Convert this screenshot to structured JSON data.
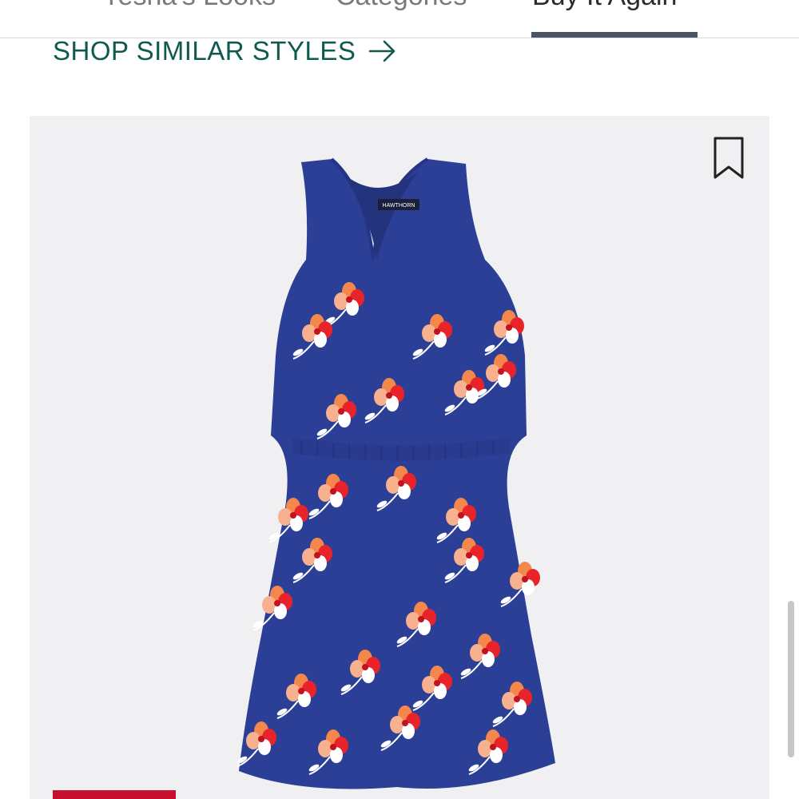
{
  "tabs": [
    {
      "label": "Yesha's Looks"
    },
    {
      "label": "Categories"
    },
    {
      "label": "Buy It Again",
      "active": true
    }
  ],
  "shop_similar": {
    "label": "SHOP SIMILAR STYLES",
    "icon": "arrow-right-icon"
  },
  "product": {
    "image": "blue-floral-sleeveless-dress",
    "brand_tag": "HAWTHORN",
    "bookmark_icon": "bookmark-icon"
  },
  "colors": {
    "link": "#0f5a4e",
    "tab_indicator": "#4b5563",
    "card_bg": "#f0f0f2",
    "dress_blue": "#2c3f97",
    "badge": "#c8102e"
  }
}
